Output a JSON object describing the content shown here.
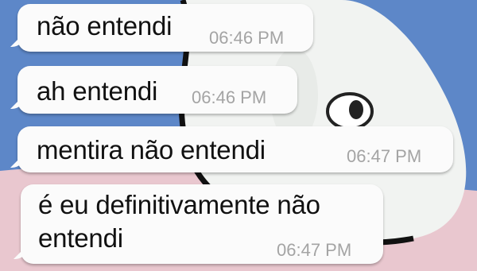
{
  "messages": [
    {
      "text": "não entendi",
      "time": "06:46 PM"
    },
    {
      "text": "ah entendi",
      "time": "06:46 PM"
    },
    {
      "text": "mentira não entendi",
      "time": "06:47 PM"
    },
    {
      "text_lines": [
        "é eu definitivamente não",
        "entendi"
      ],
      "time": "06:47 PM"
    }
  ]
}
